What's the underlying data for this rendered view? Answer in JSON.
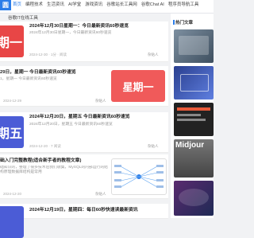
{
  "logo": "圆",
  "nav": [
    "首页",
    "编程技术",
    "生活资讯",
    "AI学堂",
    "游戏资讯",
    "谷歌站长工具网",
    "谷歌Chat AI",
    "程序员导航工具"
  ],
  "subtab": "谷歌IT在线工具",
  "posts": [
    {
      "thumb_text": "期一",
      "title": "2024年12月30日星期一：今日最新资讯60秒速览",
      "desc": "2024年12月30日星期一，今日最新资讯60秒速览",
      "meta": "2024-12-30  ·  1分  ·  阅读",
      "category": "杂贴人",
      "thumb_color": "#e84646"
    },
    {
      "thumb_text": "星期一",
      "title": "29日，星期一 今日最新资讯60秒速览",
      "desc": "1，星期一 今日最新资讯60秒速览",
      "meta": "2024-12-29",
      "category": "杂贴人",
      "thumb_color": "#f05a5a"
    },
    {
      "thumb_text": "期五",
      "title": "2024年12月20日，星期五 今日最新资讯60秒速览",
      "desc": "2024年12月20日，星期五 今日最新资讯60秒速览",
      "meta": "2024-12-20  ·  7 阅读",
      "category": "杂贴人",
      "thumb_color": "#4b5cd6"
    },
    {
      "thumb_text": "",
      "title": "础入门完整教程(适合新手者的教程文章)",
      "desc": "础知识的，整理了很多技术后我们收集，MySQL的内部运行的结构原理数据库结构是常用",
      "meta": "2024-12-20",
      "category": "杂贴人",
      "thumb_color": "#ffffff"
    },
    {
      "thumb_text": "",
      "title": "2024年12月19日，星期四：每日60秒快速读最新资讯",
      "desc": "",
      "meta": "",
      "category": "",
      "thumb_color": "#ffffff"
    }
  ],
  "sidebar": {
    "title": "热门文章",
    "items": [
      {
        "caption": "",
        "color": "#5a6b7a"
      },
      {
        "caption": "",
        "color": "#3a4fa0"
      },
      {
        "caption": "",
        "color": "#2a2a2a"
      },
      {
        "caption": "Midjour",
        "color": "#555555"
      },
      {
        "caption": "",
        "color": "#3b2a4f"
      }
    ]
  }
}
